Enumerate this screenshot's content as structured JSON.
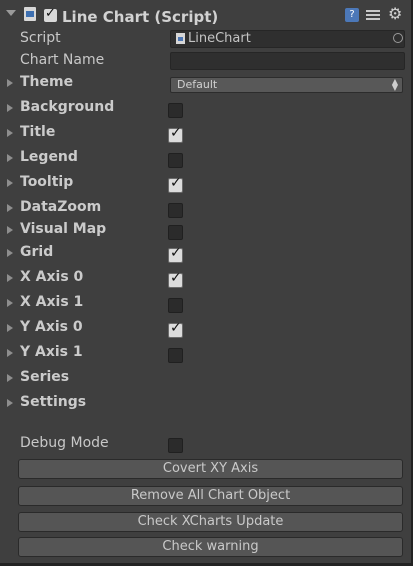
{
  "header": {
    "title": "Line Chart (Script)",
    "help_icon": "help-icon",
    "enabled": true
  },
  "properties": {
    "script_label": "Script",
    "script_value": "LineChart",
    "chart_name_label": "Chart Name",
    "chart_name_value": ""
  },
  "theme": {
    "label": "Theme",
    "value": "Default"
  },
  "foldouts": [
    {
      "label": "Background",
      "checked": false
    },
    {
      "label": "Title",
      "checked": true
    },
    {
      "label": "Legend",
      "checked": false
    },
    {
      "label": "Tooltip",
      "checked": true
    },
    {
      "label": "DataZoom",
      "checked": false
    },
    {
      "label": "Visual Map",
      "checked": false
    },
    {
      "label": "Grid",
      "checked": true
    },
    {
      "label": "X Axis 0",
      "checked": true
    },
    {
      "label": "X Axis 1",
      "checked": false
    },
    {
      "label": "Y Axis 0",
      "checked": true
    },
    {
      "label": "Y Axis 1",
      "checked": false
    },
    {
      "label": "Series"
    },
    {
      "label": "Settings"
    }
  ],
  "debug": {
    "label": "Debug Mode",
    "checked": false
  },
  "buttons": {
    "covert": "Covert XY Axis",
    "remove": "Remove All Chart Object",
    "check_update": "Check XCharts Update",
    "check_warning": "Check warning"
  },
  "colors": {
    "background": "#3f3f3f",
    "button": "#555555",
    "text": "#c8c8c8",
    "accent": "#4c78b8"
  }
}
